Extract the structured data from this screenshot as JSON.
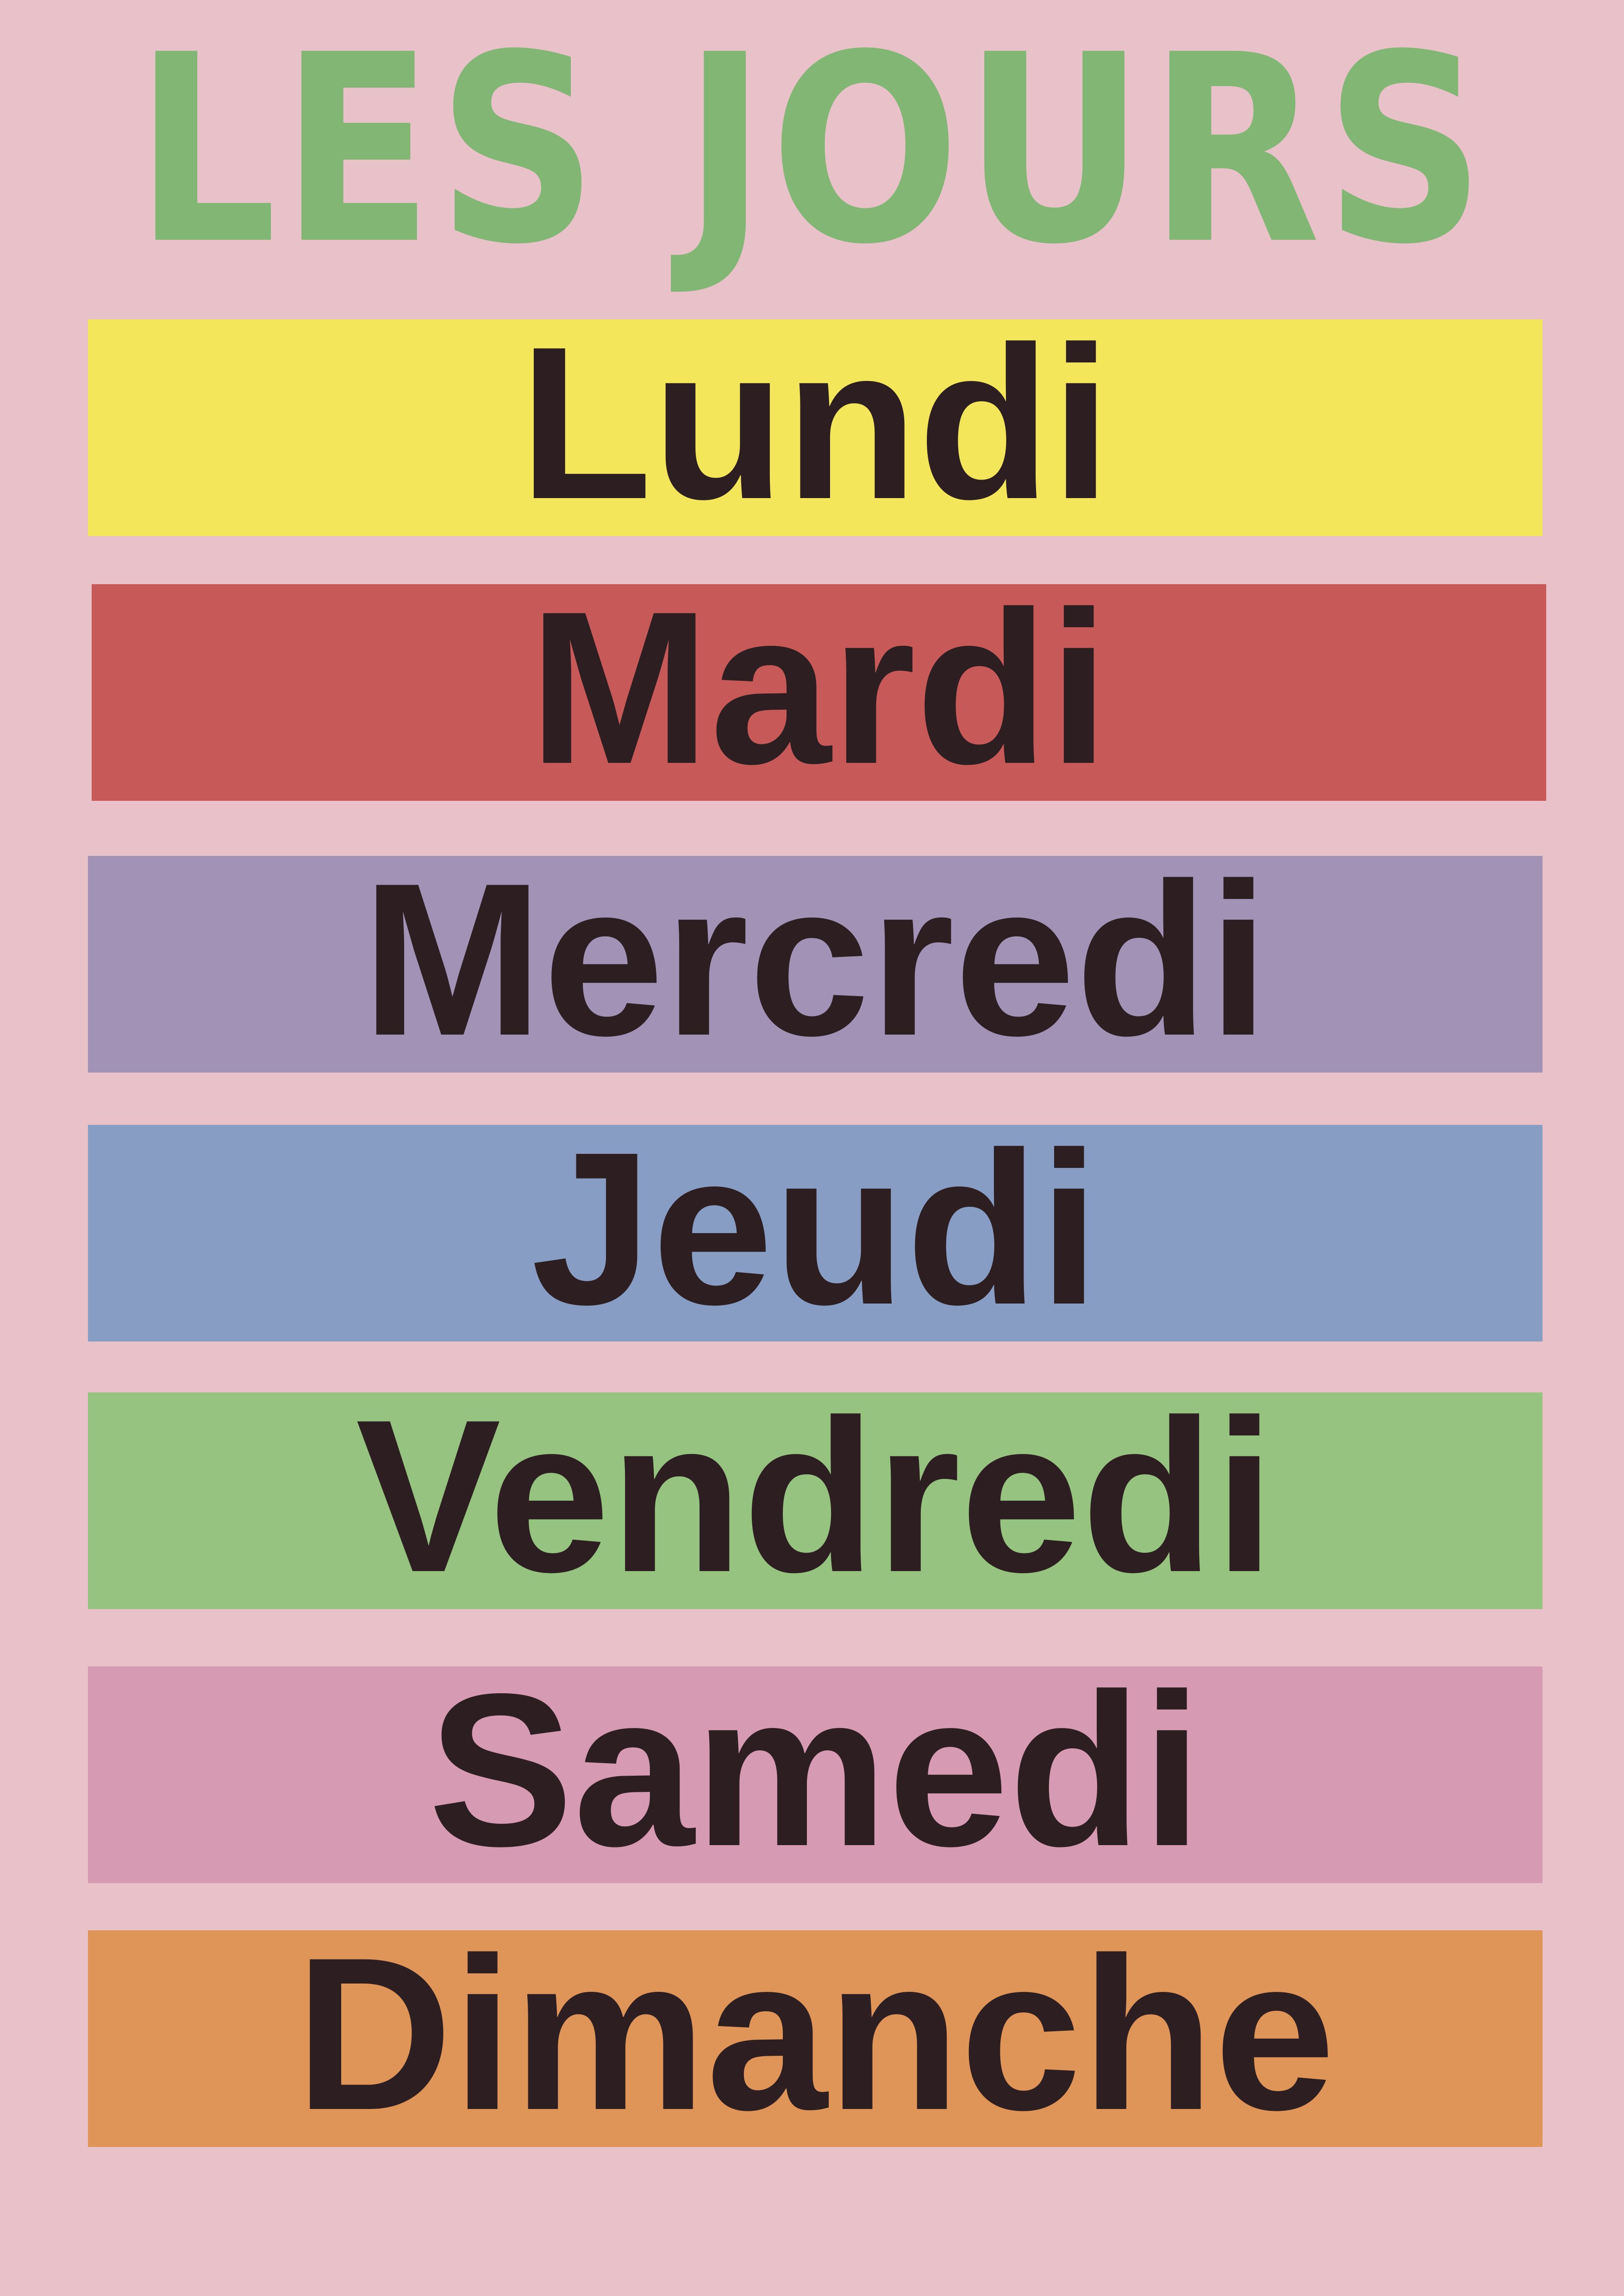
{
  "title": "LES JOURS",
  "days": [
    {
      "label": "Lundi",
      "color": "#f3e65a"
    },
    {
      "label": "Mardi",
      "color": "#c75a58"
    },
    {
      "label": "Mercredi",
      "color": "#a292b6"
    },
    {
      "label": "Jeudi",
      "color": "#879dc3"
    },
    {
      "label": "Vendredi",
      "color": "#96c37f"
    },
    {
      "label": "Samedi",
      "color": "#d79ab3"
    },
    {
      "label": "Dimanche",
      "color": "#e09558"
    }
  ],
  "colors": {
    "background": "#e8c2c8",
    "title": "#82b674",
    "text": "#2d1f21"
  }
}
